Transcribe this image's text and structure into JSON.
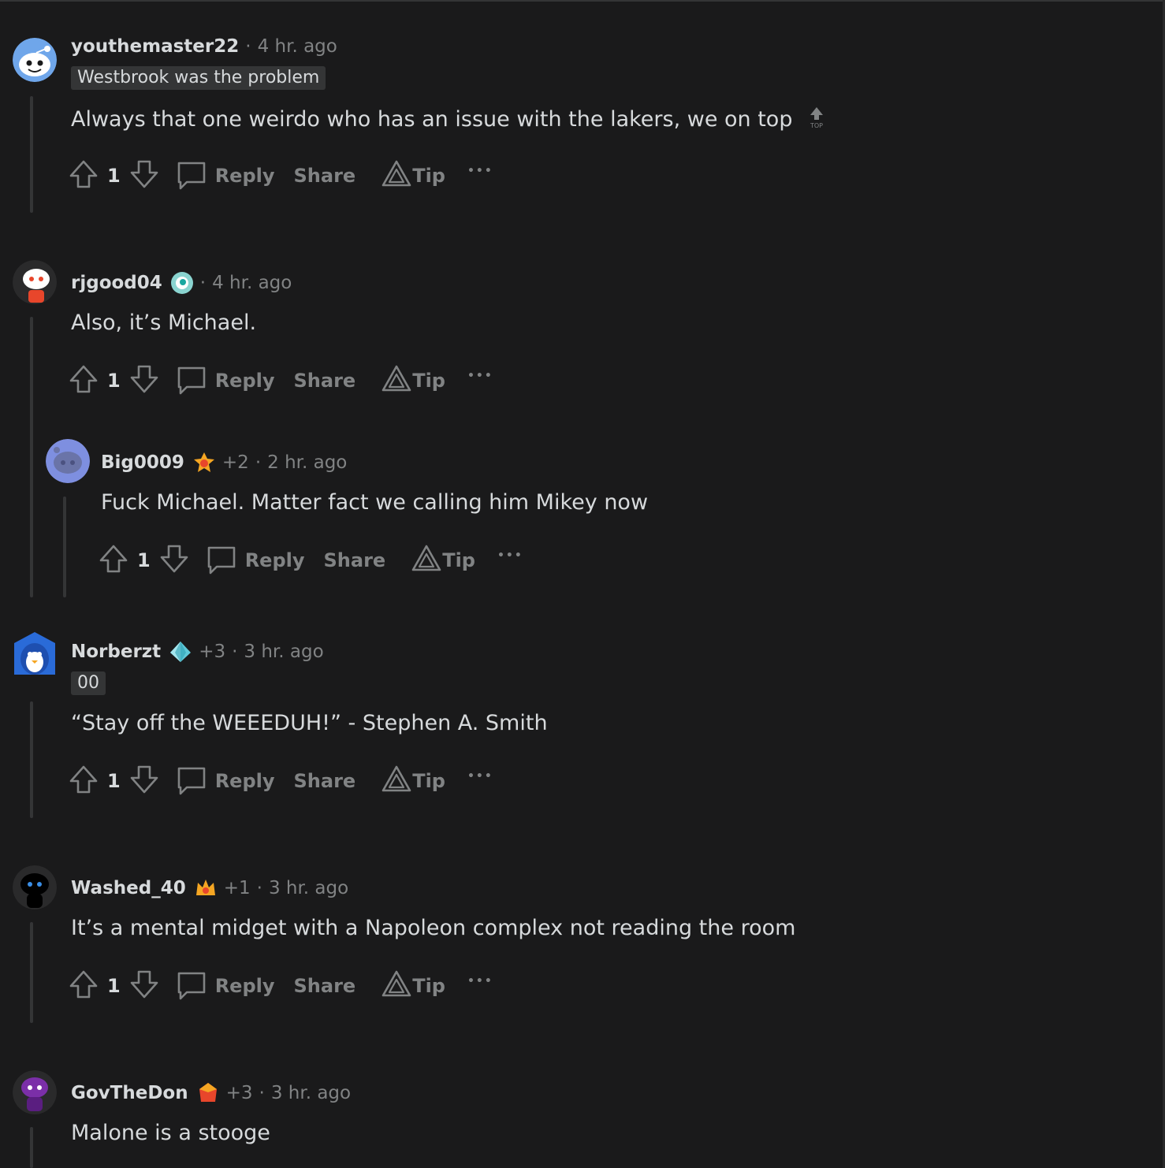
{
  "comments": [
    {
      "username": "youthemaster22",
      "time": "4 hr. ago",
      "flair": "Westbrook was the problem",
      "body": "Always that one weirdo who has an issue with the lakers, we on top",
      "badge": "TOP",
      "votes": "1",
      "avatar": "snoo-blue-icon"
    },
    {
      "username": "rjgood04",
      "time": "4 hr. ago",
      "body": "Also, it’s Michael.",
      "votes": "1",
      "avatar": "snoo-white-icon"
    },
    {
      "username": "Big0009",
      "plus": "+2",
      "time": "2 hr. ago",
      "body": "Fuck Michael. Matter fact we calling him Mikey now",
      "votes": "1",
      "avatar": "snoo-purple-icon"
    },
    {
      "username": "Norberzt",
      "plus": "+3",
      "time": "3 hr. ago",
      "flair": "00",
      "body": "“Stay off the WEEEDUH!” - Stephen A. Smith",
      "votes": "1",
      "avatar": "snoo-penguin-icon"
    },
    {
      "username": "Washed_40",
      "plus": "+1",
      "time": "3 hr. ago",
      "body": "It’s a mental midget with a Napoleon complex not reading the room",
      "votes": "1",
      "avatar": "snoo-black-icon"
    },
    {
      "username": "GovTheDon",
      "plus": "+3",
      "time": "3 hr. ago",
      "body": "Malone is a stooge",
      "avatar": "snoo-alien-icon"
    }
  ],
  "actions": {
    "reply": "Reply",
    "share": "Share",
    "tip": "Tip",
    "more": "•••"
  },
  "separator": "·"
}
